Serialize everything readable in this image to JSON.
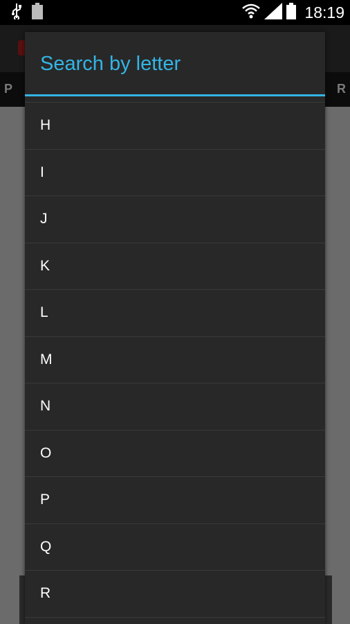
{
  "status_bar": {
    "time": "18:19",
    "battery_level_text": "100",
    "icons": [
      "usb-icon",
      "battery-full-icon",
      "wifi-icon",
      "signal-icon",
      "battery-icon"
    ]
  },
  "background": {
    "tab_left": "P",
    "tab_right": "R"
  },
  "dialog": {
    "title": "Search by letter",
    "accent_color": "#33b5e5",
    "items": [
      "H",
      "I",
      "J",
      "K",
      "L",
      "M",
      "N",
      "O",
      "P",
      "Q",
      "R"
    ]
  }
}
